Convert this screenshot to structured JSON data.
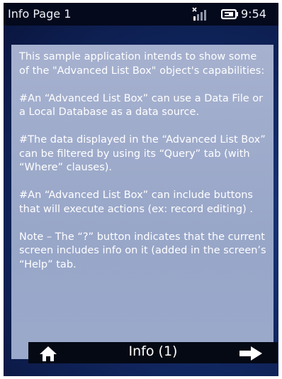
{
  "status_bar": {
    "title": "Info Page 1",
    "time": "9:54",
    "signal_icon": "no-signal-icon",
    "battery_icon": "battery-charging-icon"
  },
  "content": {
    "paragraphs": [
      "This sample application intends to show some of the  \"Advanced List Box\" object's capabilities:",
      "#An “Advanced List Box” can use a Data File or a Local  Database as a data source.",
      "#The data displayed in the “Advanced List Box” can be  filtered by using its “Query” tab (with “Where” clauses).",
      "#An “Advanced List Box” can include buttons that will execute actions (ex: record editing) .",
      "Note – The “?” button indicates that the current screen includes info on it (added in the screen’s “Help” tab."
    ]
  },
  "toolbar": {
    "title": "Info (1)",
    "home_icon": "home-icon",
    "next_icon": "arrow-right-icon"
  },
  "colors": {
    "status_bar_bg": "#04091c",
    "panel_bg": "#a3aecd",
    "toolbar_bg": "#050914",
    "text": "#ffffff"
  }
}
